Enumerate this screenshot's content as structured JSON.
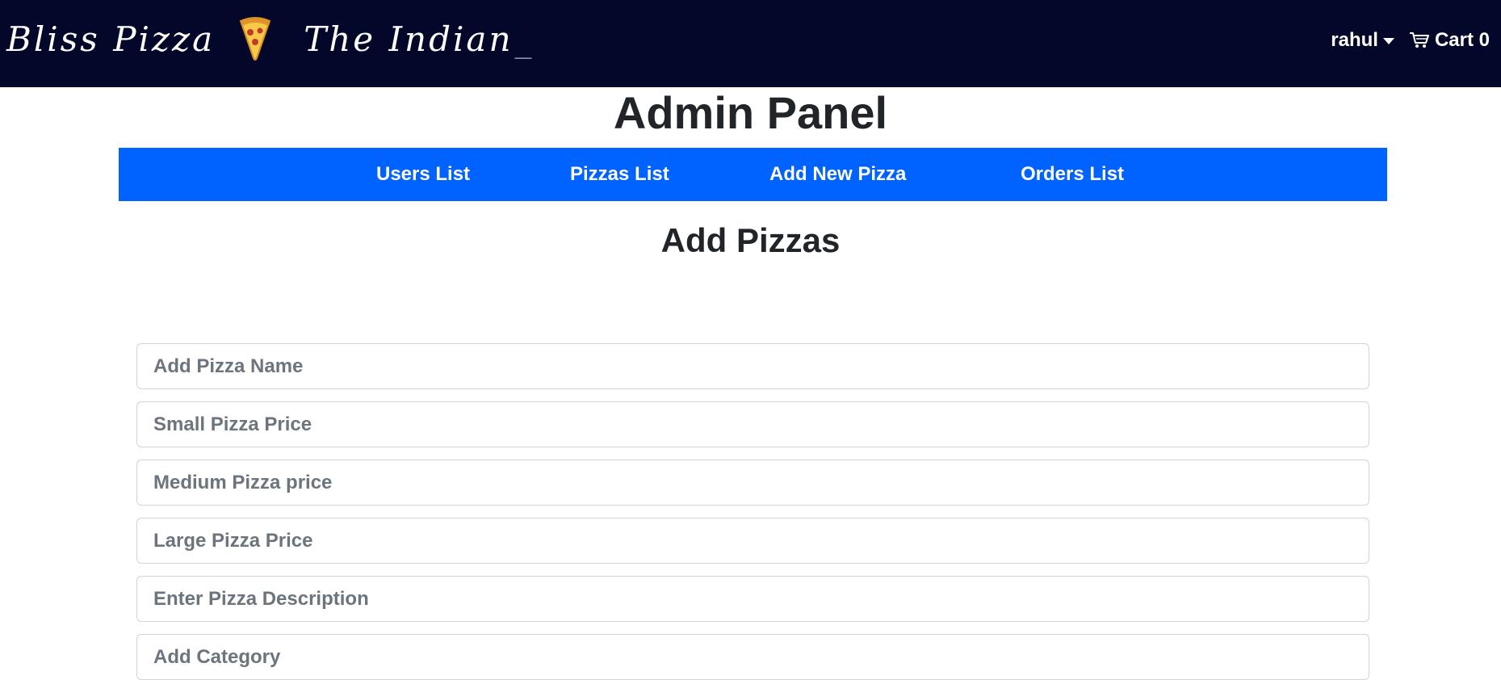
{
  "navbar": {
    "brand_name": "Bliss Pizza",
    "brand_tagline": "The Indian",
    "brand_cursor": "_",
    "user_name": "rahul",
    "cart_label": "Cart 0",
    "background_color": "#03072a"
  },
  "admin": {
    "title": "Admin Panel",
    "tabs": [
      {
        "label": "Users List"
      },
      {
        "label": "Pizzas List"
      },
      {
        "label": "Add New Pizza"
      },
      {
        "label": "Orders List"
      }
    ],
    "tabs_background_color": "#0063ff"
  },
  "form": {
    "title": "Add Pizzas",
    "fields": [
      {
        "placeholder": "Add Pizza Name",
        "value": ""
      },
      {
        "placeholder": "Small Pizza Price",
        "value": ""
      },
      {
        "placeholder": "Medium Pizza price",
        "value": ""
      },
      {
        "placeholder": "Large Pizza Price",
        "value": ""
      },
      {
        "placeholder": "Enter Pizza Description",
        "value": ""
      },
      {
        "placeholder": "Add Category",
        "value": ""
      }
    ]
  },
  "icons": {
    "brand_icon": "pizza-slice-icon",
    "user_caret": "chevron-down-icon",
    "cart_icon": "shopping-cart-icon"
  }
}
